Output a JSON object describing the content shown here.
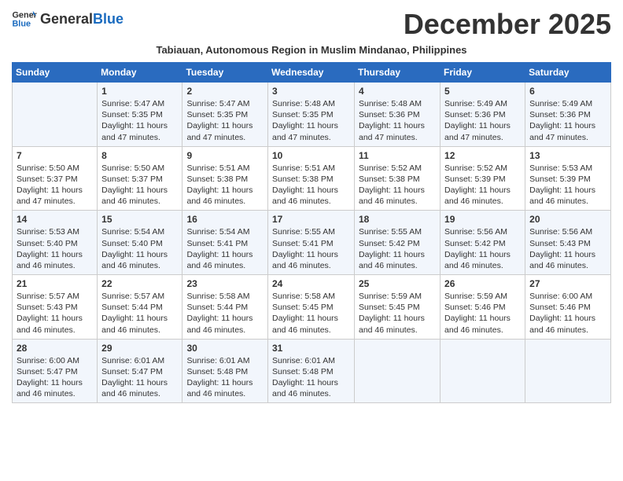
{
  "header": {
    "logo_general": "General",
    "logo_blue": "Blue",
    "month_year": "December 2025",
    "subtitle": "Tabiauan, Autonomous Region in Muslim Mindanao, Philippines"
  },
  "days_of_week": [
    "Sunday",
    "Monday",
    "Tuesday",
    "Wednesday",
    "Thursday",
    "Friday",
    "Saturday"
  ],
  "weeks": [
    [
      {
        "day": "",
        "info": ""
      },
      {
        "day": "1",
        "info": "Sunrise: 5:47 AM\nSunset: 5:35 PM\nDaylight: 11 hours\nand 47 minutes."
      },
      {
        "day": "2",
        "info": "Sunrise: 5:47 AM\nSunset: 5:35 PM\nDaylight: 11 hours\nand 47 minutes."
      },
      {
        "day": "3",
        "info": "Sunrise: 5:48 AM\nSunset: 5:35 PM\nDaylight: 11 hours\nand 47 minutes."
      },
      {
        "day": "4",
        "info": "Sunrise: 5:48 AM\nSunset: 5:36 PM\nDaylight: 11 hours\nand 47 minutes."
      },
      {
        "day": "5",
        "info": "Sunrise: 5:49 AM\nSunset: 5:36 PM\nDaylight: 11 hours\nand 47 minutes."
      },
      {
        "day": "6",
        "info": "Sunrise: 5:49 AM\nSunset: 5:36 PM\nDaylight: 11 hours\nand 47 minutes."
      }
    ],
    [
      {
        "day": "7",
        "info": "Sunrise: 5:50 AM\nSunset: 5:37 PM\nDaylight: 11 hours\nand 47 minutes."
      },
      {
        "day": "8",
        "info": "Sunrise: 5:50 AM\nSunset: 5:37 PM\nDaylight: 11 hours\nand 46 minutes."
      },
      {
        "day": "9",
        "info": "Sunrise: 5:51 AM\nSunset: 5:38 PM\nDaylight: 11 hours\nand 46 minutes."
      },
      {
        "day": "10",
        "info": "Sunrise: 5:51 AM\nSunset: 5:38 PM\nDaylight: 11 hours\nand 46 minutes."
      },
      {
        "day": "11",
        "info": "Sunrise: 5:52 AM\nSunset: 5:38 PM\nDaylight: 11 hours\nand 46 minutes."
      },
      {
        "day": "12",
        "info": "Sunrise: 5:52 AM\nSunset: 5:39 PM\nDaylight: 11 hours\nand 46 minutes."
      },
      {
        "day": "13",
        "info": "Sunrise: 5:53 AM\nSunset: 5:39 PM\nDaylight: 11 hours\nand 46 minutes."
      }
    ],
    [
      {
        "day": "14",
        "info": "Sunrise: 5:53 AM\nSunset: 5:40 PM\nDaylight: 11 hours\nand 46 minutes."
      },
      {
        "day": "15",
        "info": "Sunrise: 5:54 AM\nSunset: 5:40 PM\nDaylight: 11 hours\nand 46 minutes."
      },
      {
        "day": "16",
        "info": "Sunrise: 5:54 AM\nSunset: 5:41 PM\nDaylight: 11 hours\nand 46 minutes."
      },
      {
        "day": "17",
        "info": "Sunrise: 5:55 AM\nSunset: 5:41 PM\nDaylight: 11 hours\nand 46 minutes."
      },
      {
        "day": "18",
        "info": "Sunrise: 5:55 AM\nSunset: 5:42 PM\nDaylight: 11 hours\nand 46 minutes."
      },
      {
        "day": "19",
        "info": "Sunrise: 5:56 AM\nSunset: 5:42 PM\nDaylight: 11 hours\nand 46 minutes."
      },
      {
        "day": "20",
        "info": "Sunrise: 5:56 AM\nSunset: 5:43 PM\nDaylight: 11 hours\nand 46 minutes."
      }
    ],
    [
      {
        "day": "21",
        "info": "Sunrise: 5:57 AM\nSunset: 5:43 PM\nDaylight: 11 hours\nand 46 minutes."
      },
      {
        "day": "22",
        "info": "Sunrise: 5:57 AM\nSunset: 5:44 PM\nDaylight: 11 hours\nand 46 minutes."
      },
      {
        "day": "23",
        "info": "Sunrise: 5:58 AM\nSunset: 5:44 PM\nDaylight: 11 hours\nand 46 minutes."
      },
      {
        "day": "24",
        "info": "Sunrise: 5:58 AM\nSunset: 5:45 PM\nDaylight: 11 hours\nand 46 minutes."
      },
      {
        "day": "25",
        "info": "Sunrise: 5:59 AM\nSunset: 5:45 PM\nDaylight: 11 hours\nand 46 minutes."
      },
      {
        "day": "26",
        "info": "Sunrise: 5:59 AM\nSunset: 5:46 PM\nDaylight: 11 hours\nand 46 minutes."
      },
      {
        "day": "27",
        "info": "Sunrise: 6:00 AM\nSunset: 5:46 PM\nDaylight: 11 hours\nand 46 minutes."
      }
    ],
    [
      {
        "day": "28",
        "info": "Sunrise: 6:00 AM\nSunset: 5:47 PM\nDaylight: 11 hours\nand 46 minutes."
      },
      {
        "day": "29",
        "info": "Sunrise: 6:01 AM\nSunset: 5:47 PM\nDaylight: 11 hours\nand 46 minutes."
      },
      {
        "day": "30",
        "info": "Sunrise: 6:01 AM\nSunset: 5:48 PM\nDaylight: 11 hours\nand 46 minutes."
      },
      {
        "day": "31",
        "info": "Sunrise: 6:01 AM\nSunset: 5:48 PM\nDaylight: 11 hours\nand 46 minutes."
      },
      {
        "day": "",
        "info": ""
      },
      {
        "day": "",
        "info": ""
      },
      {
        "day": "",
        "info": ""
      }
    ]
  ]
}
